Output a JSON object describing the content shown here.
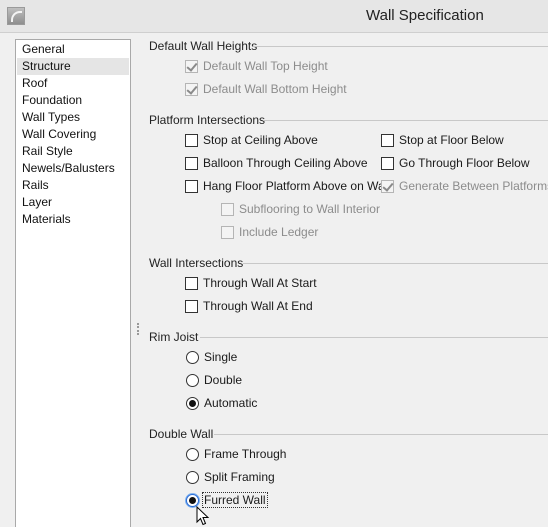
{
  "window": {
    "title": "Wall Specification"
  },
  "sidebar": {
    "items": [
      {
        "label": "General"
      },
      {
        "label": "Structure"
      },
      {
        "label": "Roof"
      },
      {
        "label": "Foundation"
      },
      {
        "label": "Wall Types"
      },
      {
        "label": "Wall Covering"
      },
      {
        "label": "Rail Style"
      },
      {
        "label": "Newels/Balusters"
      },
      {
        "label": "Rails"
      },
      {
        "label": "Layer"
      },
      {
        "label": "Materials"
      }
    ],
    "selected": "Structure"
  },
  "default_wall_heights": {
    "title": "Default Wall Heights",
    "top_height": {
      "label": "Default Wall Top Height",
      "checked": true,
      "enabled": false
    },
    "bottom_height": {
      "label": "Default Wall Bottom Height",
      "checked": true,
      "enabled": false
    }
  },
  "platform_intersections": {
    "title": "Platform Intersections",
    "stop_ceiling": {
      "label": "Stop at Ceiling Above",
      "checked": false
    },
    "stop_floor": {
      "label": "Stop at Floor Below",
      "checked": false
    },
    "balloon": {
      "label": "Balloon Through Ceiling Above",
      "checked": false
    },
    "go_through": {
      "label": "Go Through Floor Below",
      "checked": false
    },
    "hang_floor": {
      "label": "Hang Floor Platform Above on Wall",
      "checked": false
    },
    "generate_between": {
      "label": "Generate Between Platforms",
      "checked": true,
      "enabled": false
    },
    "subflooring": {
      "label": "Subflooring to Wall Interior",
      "checked": false,
      "enabled": false
    },
    "ledger": {
      "label": "Include Ledger",
      "checked": false,
      "enabled": false
    }
  },
  "wall_intersections": {
    "title": "Wall Intersections",
    "at_start": {
      "label": "Through Wall At Start",
      "checked": false
    },
    "at_end": {
      "label": "Through Wall At End",
      "checked": false
    }
  },
  "rim_joist": {
    "title": "Rim Joist",
    "options": [
      "Single",
      "Double",
      "Automatic"
    ],
    "selected": "Automatic"
  },
  "double_wall": {
    "title": "Double Wall",
    "options": [
      "Frame Through",
      "Split Framing",
      "Furred Wall"
    ],
    "selected": "Furred Wall"
  },
  "icons": {
    "app": "app-icon",
    "cursor": "mouse-pointer-icon"
  }
}
